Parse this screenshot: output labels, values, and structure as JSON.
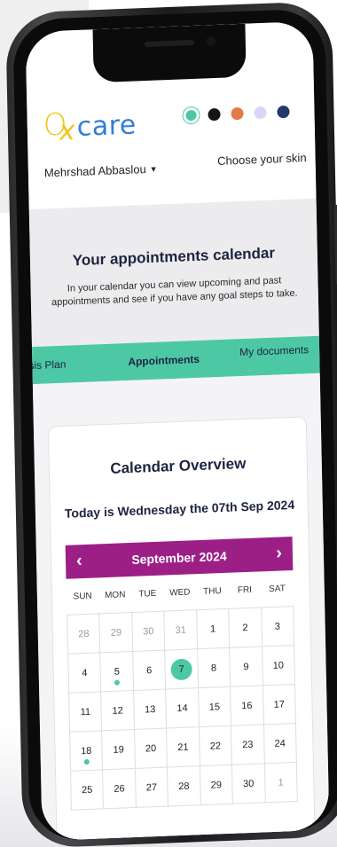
{
  "header": {
    "logo_o": "O",
    "logo_x": "x",
    "logo_care": "care",
    "user_name": "Mehrshad Abbaslou",
    "user_caret": "▼",
    "choose_skin": "Choose your skin",
    "skin_colors": [
      "#4cc7a6",
      "#151515",
      "#e27a4a",
      "#d8d6f8",
      "#1f3a6b"
    ]
  },
  "hero": {
    "title": "Your appointments calendar",
    "text": "In your calendar you can view upcoming and past appointments and see if you have any goal steps to take."
  },
  "tabs": [
    {
      "label": "sis Plan"
    },
    {
      "label": "Appointments"
    },
    {
      "label": "My documents"
    }
  ],
  "calendar": {
    "card_title": "Calendar Overview",
    "today_text": "Today is Wednesday the 07th Sep 2024",
    "month_label": "September 2024",
    "prev_icon": "‹",
    "next_icon": "›",
    "weekdays": [
      "SUN",
      "MON",
      "TUE",
      "WED",
      "THU",
      "FRI",
      "SAT"
    ],
    "weeks": [
      [
        "28",
        "29",
        "30",
        "31",
        "1",
        "2",
        "3"
      ],
      [
        "4",
        "5",
        "6",
        "7",
        "8",
        "9",
        "10"
      ],
      [
        "11",
        "12",
        "13",
        "14",
        "15",
        "16",
        "17"
      ],
      [
        "18",
        "19",
        "20",
        "21",
        "22",
        "23",
        "24"
      ],
      [
        "25",
        "26",
        "27",
        "28",
        "29",
        "30",
        "1"
      ]
    ],
    "accent_color": "#9c1f86",
    "highlight_color": "#4dc8a5"
  }
}
